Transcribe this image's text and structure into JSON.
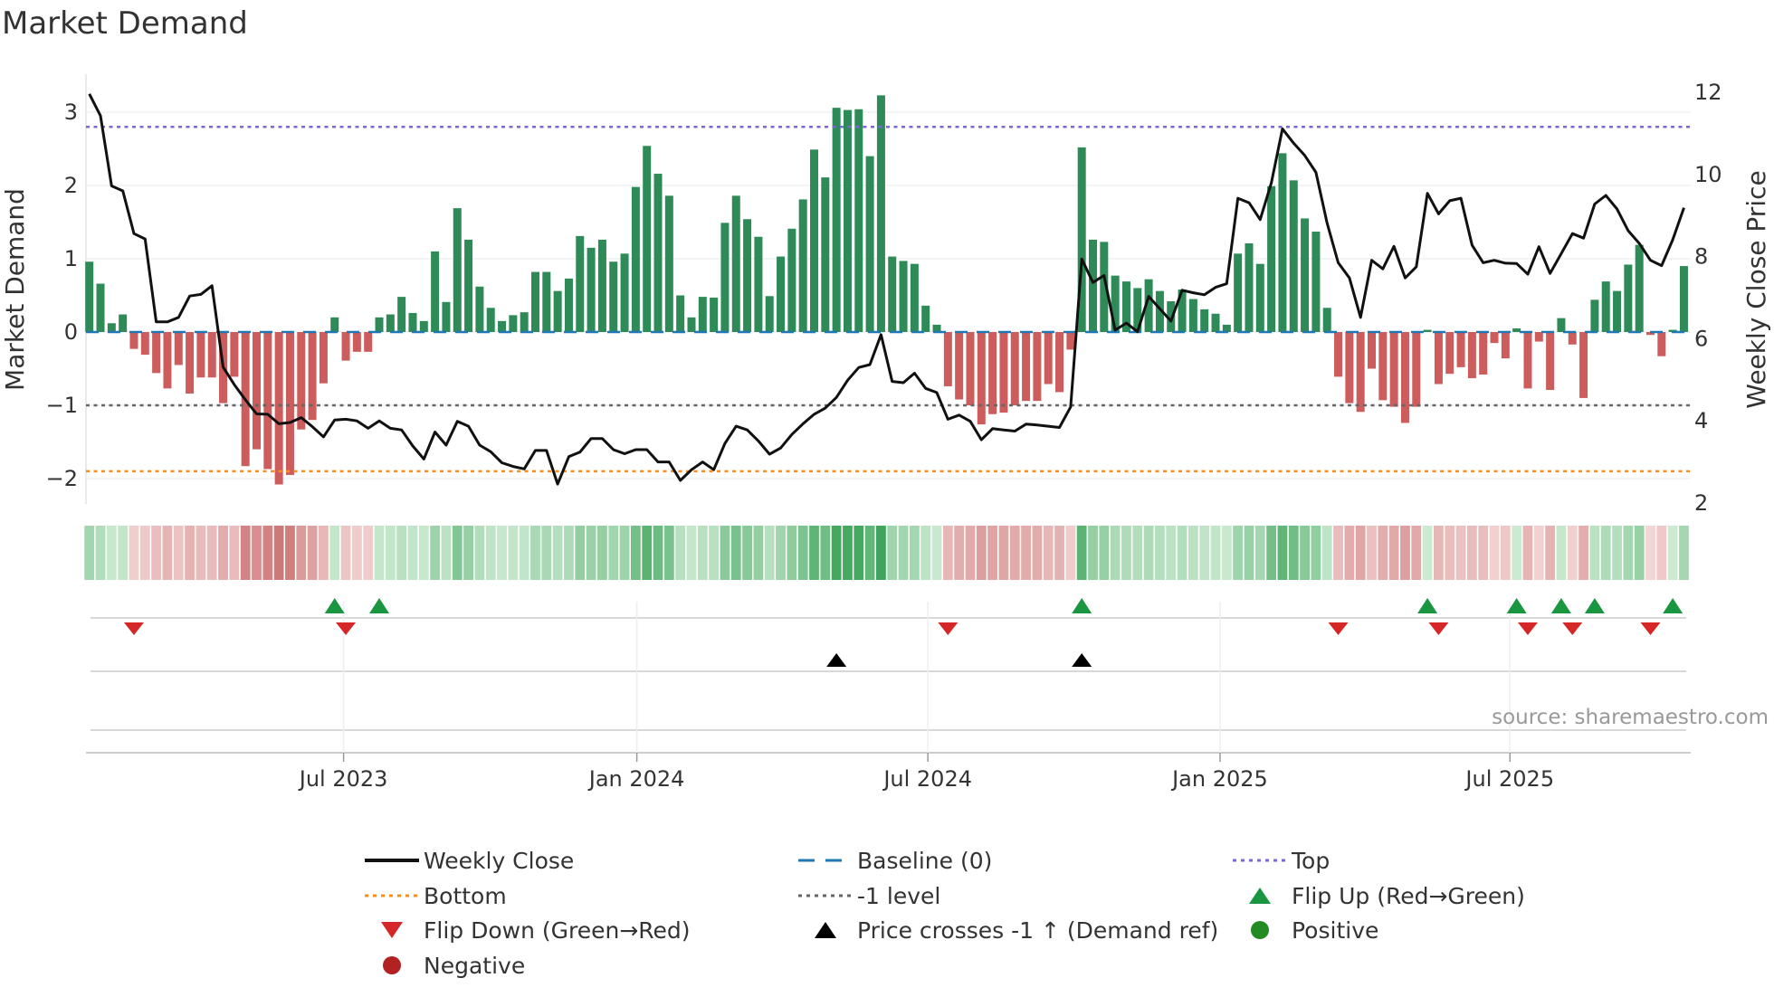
{
  "title": "Market Demand",
  "source": "source: sharemaestro.com",
  "colors": {
    "positive_bar": "#2e8b57",
    "negative_bar": "#cd5c5c",
    "price_line": "#111111",
    "baseline": "#1f77b4",
    "top": "#7b68d8",
    "bottom": "#ff8c1a",
    "minus_one": "#666666",
    "flip_up": "#1a9641",
    "flip_down": "#d62728",
    "price_cross": "#000000",
    "positive_dot": "#228b22",
    "negative_dot": "#b22222"
  },
  "chart_data": {
    "type": "bar+line",
    "title": "Market Demand",
    "ylabel": "Market Demand",
    "y2label": "Weekly Close Price",
    "ylim": [
      -2.3,
      3.6
    ],
    "y2lim": [
      1.8,
      12.4
    ],
    "yticks": [
      -2,
      -1,
      0,
      1,
      2,
      3
    ],
    "ytick_labels": [
      "−2",
      "−1",
      "0",
      "1",
      "2",
      "3"
    ],
    "y2ticks": [
      2,
      4,
      6,
      8,
      10,
      12
    ],
    "y2tick_labels": [
      "2",
      "4",
      "6",
      "8",
      "10",
      "12"
    ],
    "x_ticks": [
      {
        "label": "Jul 2023",
        "week": 22.8
      },
      {
        "label": "Jan 2024",
        "week": 49.1
      },
      {
        "label": "Jul 2024",
        "week": 75.2
      },
      {
        "label": "Jan 2025",
        "week": 101.4
      },
      {
        "label": "Jul 2025",
        "week": 127.4
      }
    ],
    "reference_lines": {
      "top": 2.8,
      "baseline": 0,
      "minus_one": -1,
      "bottom": -1.9
    },
    "demand": [
      0.96,
      0.66,
      0.12,
      0.24,
      -0.23,
      -0.31,
      -0.56,
      -0.77,
      -0.45,
      -0.84,
      -0.62,
      -0.62,
      -0.97,
      -0.61,
      -1.83,
      -1.6,
      -1.87,
      -2.08,
      -1.95,
      -1.33,
      -1.2,
      -0.7,
      0.2,
      -0.39,
      -0.27,
      -0.27,
      0.2,
      0.24,
      0.48,
      0.26,
      0.15,
      1.1,
      0.41,
      1.69,
      1.26,
      0.62,
      0.33,
      0.15,
      0.23,
      0.27,
      0.82,
      0.82,
      0.56,
      0.73,
      1.31,
      1.15,
      1.26,
      0.96,
      1.07,
      1.98,
      2.54,
      2.16,
      1.86,
      0.5,
      0.2,
      0.48,
      0.47,
      1.49,
      1.86,
      1.54,
      1.3,
      0.49,
      1.03,
      1.41,
      1.81,
      2.49,
      2.11,
      3.06,
      3.03,
      3.04,
      2.4,
      3.23,
      1.03,
      0.97,
      0.93,
      0.36,
      0.1,
      -0.74,
      -0.92,
      -1.0,
      -1.26,
      -1.12,
      -1.1,
      -1.0,
      -0.94,
      -0.94,
      -0.71,
      -0.82,
      -0.24,
      2.52,
      1.26,
      1.23,
      0.77,
      0.69,
      0.6,
      0.72,
      0.56,
      0.42,
      0.58,
      0.45,
      0.31,
      0.25,
      0.1,
      1.07,
      1.21,
      0.93,
      1.99,
      2.44,
      2.07,
      1.55,
      1.37,
      0.33,
      -0.61,
      -0.97,
      -1.09,
      -0.5,
      -0.93,
      -1.02,
      -1.24,
      -1.02,
      0.03,
      -0.71,
      -0.57,
      -0.48,
      -0.63,
      -0.58,
      -0.15,
      -0.36,
      0.05,
      -0.77,
      -0.13,
      -0.79,
      0.19,
      -0.17,
      -0.9,
      0.44,
      0.69,
      0.56,
      0.92,
      1.19,
      -0.04,
      -0.33,
      0.03,
      0.9
    ],
    "weekly_close": [
      11.96,
      11.43,
      9.72,
      9.6,
      8.56,
      8.43,
      6.41,
      6.41,
      6.52,
      7.04,
      7.08,
      7.29,
      5.31,
      4.88,
      4.51,
      4.17,
      4.16,
      3.93,
      3.96,
      4.08,
      3.86,
      3.61,
      4.02,
      4.04,
      4.0,
      3.82,
      4.0,
      3.82,
      3.78,
      3.39,
      3.07,
      3.73,
      3.41,
      3.99,
      3.87,
      3.41,
      3.25,
      2.98,
      2.89,
      2.83,
      3.28,
      3.28,
      2.46,
      3.13,
      3.24,
      3.57,
      3.57,
      3.3,
      3.2,
      3.3,
      3.3,
      3.0,
      3.0,
      2.55,
      2.81,
      3.0,
      2.81,
      3.45,
      3.87,
      3.78,
      3.51,
      3.19,
      3.34,
      3.67,
      3.93,
      4.16,
      4.31,
      4.57,
      4.99,
      5.3,
      5.37,
      6.1,
      4.96,
      4.93,
      5.16,
      4.79,
      4.69,
      4.04,
      4.14,
      3.99,
      3.54,
      3.81,
      3.78,
      3.75,
      3.92,
      3.9,
      3.87,
      3.84,
      4.34,
      7.94,
      7.37,
      7.54,
      6.21,
      6.38,
      6.17,
      7.03,
      6.73,
      6.43,
      7.18,
      7.12,
      7.07,
      7.25,
      7.34,
      9.42,
      9.31,
      8.9,
      9.79,
      11.11,
      10.76,
      10.46,
      10.05,
      8.82,
      7.85,
      7.48,
      6.52,
      7.91,
      7.7,
      8.25,
      7.48,
      7.75,
      9.54,
      9.04,
      9.36,
      9.42,
      8.28,
      7.85,
      7.91,
      7.84,
      7.83,
      7.57,
      8.24,
      7.59,
      8.07,
      8.56,
      8.45,
      9.28,
      9.49,
      9.16,
      8.63,
      8.32,
      7.91,
      7.78,
      8.41,
      9.19
    ],
    "price_cross_weeks": [
      67,
      89
    ],
    "legend_placement": "bottom"
  },
  "legend": {
    "weekly_close": "Weekly Close",
    "baseline": "Baseline (0)",
    "top": "Top",
    "bottom": "Bottom",
    "minus_one": "-1 level",
    "flip_up": "Flip Up (Red→Green)",
    "flip_down": "Flip Down (Green→Red)",
    "price_cross": "Price crosses -1 ↑ (Demand ref)",
    "positive": "Positive",
    "negative": "Negative"
  }
}
